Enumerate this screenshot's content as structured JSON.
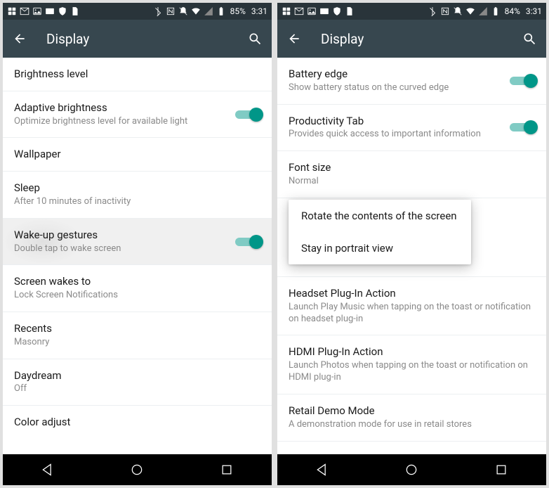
{
  "left": {
    "status": {
      "battery": "85%",
      "time": "3:31"
    },
    "appbar": {
      "title": "Display"
    },
    "rows": [
      {
        "primary": "Brightness level"
      },
      {
        "primary": "Adaptive brightness",
        "secondary": "Optimize brightness level for available light",
        "toggle": true
      },
      {
        "primary": "Wallpaper"
      },
      {
        "primary": "Sleep",
        "secondary": "After 10 minutes of inactivity"
      },
      {
        "primary": "Wake-up gestures",
        "secondary": "Double tap to wake screen",
        "toggle": true,
        "highlight": true
      },
      {
        "primary": "Screen wakes to",
        "secondary": "Lock Screen Notifications"
      },
      {
        "primary": "Recents",
        "secondary": "Masonry"
      },
      {
        "primary": "Daydream",
        "secondary": "Off"
      },
      {
        "primary": "Color adjust"
      }
    ]
  },
  "right": {
    "status": {
      "battery": "84%",
      "time": "3:31"
    },
    "appbar": {
      "title": "Display"
    },
    "rows": [
      {
        "primary": "Battery edge",
        "secondary": "Show battery status on the curved edge",
        "toggle": true
      },
      {
        "primary": "Productivity Tab",
        "secondary": "Provides quick access to important information",
        "toggle": true
      },
      {
        "primary": "Font size",
        "secondary": "Normal"
      },
      {
        "primary": "",
        "secondary": ""
      },
      {
        "primary": "Headset Plug-In Action",
        "secondary": "Launch Play Music when tapping on the toast or notification on headset plug-in"
      },
      {
        "primary": "HDMI Plug-In Action",
        "secondary": "Launch Photos when tapping on the toast or notification on HDMI plug-in"
      },
      {
        "primary": "Retail Demo Mode",
        "secondary": "A demonstration mode for use in retail stores"
      }
    ],
    "popup": {
      "items": [
        "Rotate the contents of the screen",
        "Stay in portrait view"
      ]
    }
  }
}
